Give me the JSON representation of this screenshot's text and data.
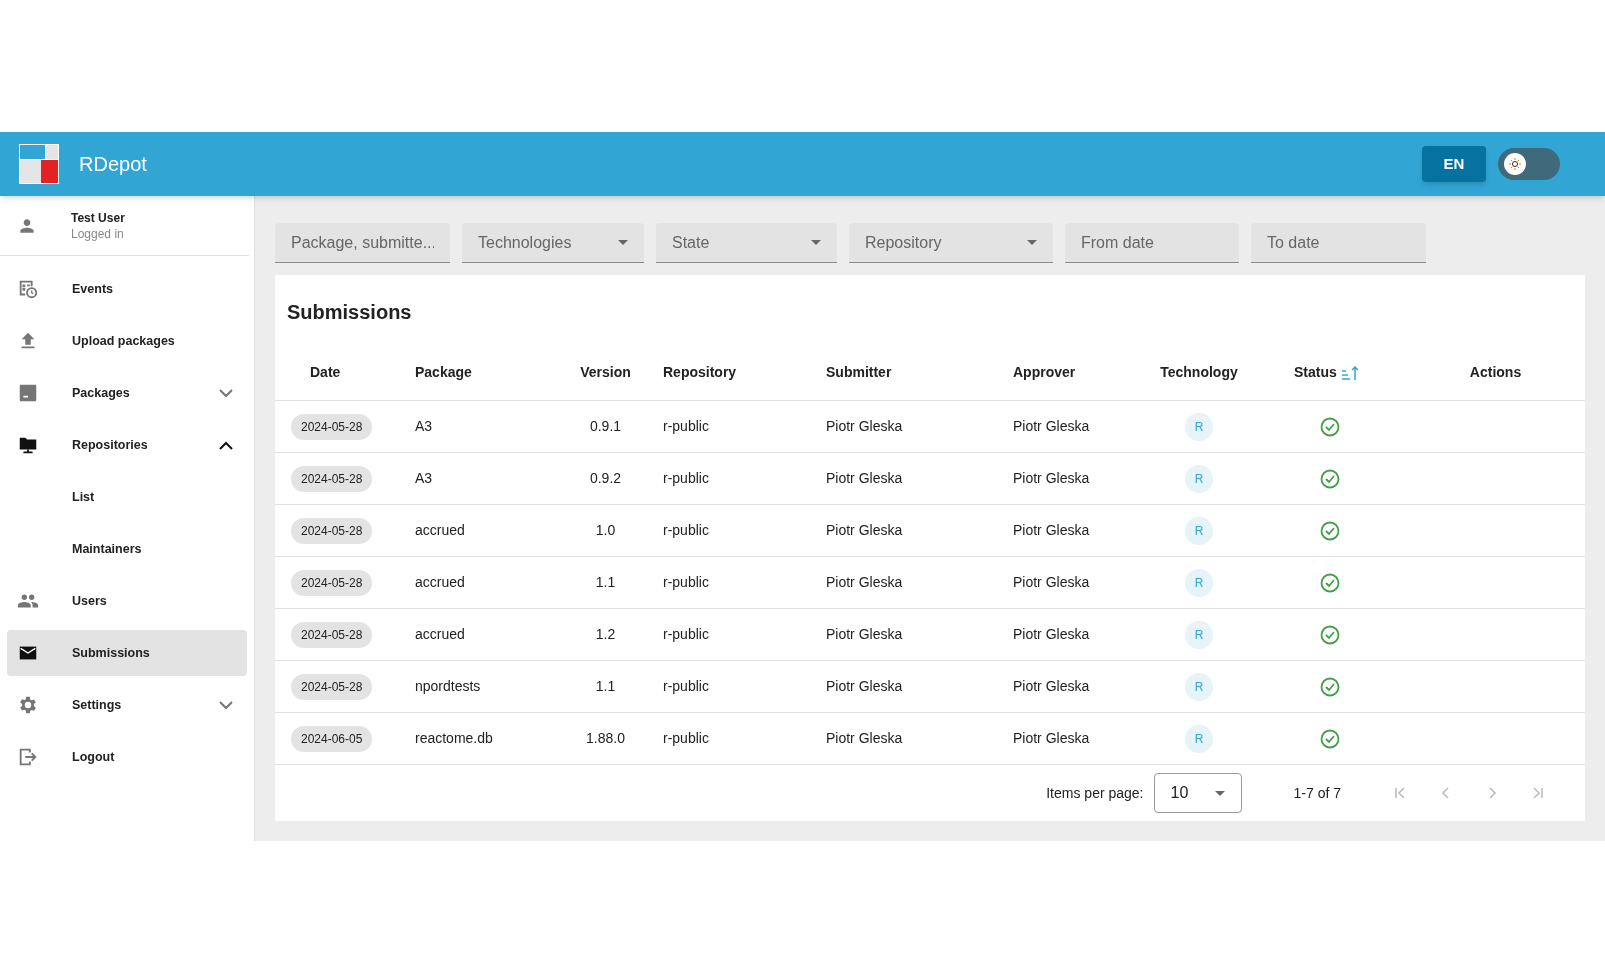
{
  "header": {
    "title": "RDepot",
    "language_button": "EN",
    "theme_toggle": {
      "on": false
    }
  },
  "user": {
    "name": "Test User",
    "status": "Logged in"
  },
  "sidebar": {
    "items": [
      {
        "label": "Events",
        "selected": false
      },
      {
        "label": "Upload packages",
        "selected": false
      },
      {
        "label": "Packages",
        "selected": false,
        "expanded": false
      },
      {
        "label": "Repositories",
        "selected": false,
        "expanded": true,
        "children": [
          {
            "label": "List",
            "selected": false
          },
          {
            "label": "Maintainers",
            "selected": false
          }
        ]
      },
      {
        "label": "Users",
        "selected": false
      },
      {
        "label": "Submissions",
        "selected": true
      },
      {
        "label": "Settings",
        "selected": false,
        "expanded": false
      },
      {
        "label": "Logout",
        "selected": false
      }
    ]
  },
  "filters": [
    {
      "kind": "text",
      "placeholder": "Package, submitte..."
    },
    {
      "kind": "select",
      "placeholder": "Technologies"
    },
    {
      "kind": "select",
      "placeholder": "State"
    },
    {
      "kind": "select",
      "placeholder": "Repository"
    },
    {
      "kind": "text",
      "placeholder": "From date"
    },
    {
      "kind": "text",
      "placeholder": "To date"
    }
  ],
  "table": {
    "title": "Submissions",
    "columns": [
      {
        "label": "Date",
        "sorted": false
      },
      {
        "label": "Package",
        "sorted": false
      },
      {
        "label": "Version",
        "sorted": false
      },
      {
        "label": "Repository",
        "sorted": false
      },
      {
        "label": "Submitter",
        "sorted": false
      },
      {
        "label": "Approver",
        "sorted": false
      },
      {
        "label": "Technology",
        "sorted": false
      },
      {
        "label": "Status",
        "sorted": true
      },
      {
        "label": "Actions",
        "sorted": false
      }
    ],
    "rows": [
      {
        "date": "2024-05-28",
        "package": "A3",
        "version": "0.9.1",
        "repository": "r-public",
        "submitter": "Piotr Gleska",
        "approver": "Piotr Gleska",
        "technology": "R",
        "accepted": true
      },
      {
        "date": "2024-05-28",
        "package": "A3",
        "version": "0.9.2",
        "repository": "r-public",
        "submitter": "Piotr Gleska",
        "approver": "Piotr Gleska",
        "technology": "R",
        "accepted": true
      },
      {
        "date": "2024-05-28",
        "package": "accrued",
        "version": "1.0",
        "repository": "r-public",
        "submitter": "Piotr Gleska",
        "approver": "Piotr Gleska",
        "technology": "R",
        "accepted": true
      },
      {
        "date": "2024-05-28",
        "package": "accrued",
        "version": "1.1",
        "repository": "r-public",
        "submitter": "Piotr Gleska",
        "approver": "Piotr Gleska",
        "technology": "R",
        "accepted": true
      },
      {
        "date": "2024-05-28",
        "package": "accrued",
        "version": "1.2",
        "repository": "r-public",
        "submitter": "Piotr Gleska",
        "approver": "Piotr Gleska",
        "technology": "R",
        "accepted": true
      },
      {
        "date": "2024-05-28",
        "package": "npordtests",
        "version": "1.1",
        "repository": "r-public",
        "submitter": "Piotr Gleska",
        "approver": "Piotr Gleska",
        "technology": "R",
        "accepted": true
      },
      {
        "date": "2024-06-05",
        "package": "reactome.db",
        "version": "1.88.0",
        "repository": "r-public",
        "submitter": "Piotr Gleska",
        "approver": "Piotr Gleska",
        "technology": "R",
        "accepted": true
      }
    ]
  },
  "pagination": {
    "label": "Items per page:",
    "page_size": "10",
    "range": "1-7 of 7",
    "first_disabled": true,
    "previous_disabled": true,
    "next_disabled": true,
    "last_disabled": true
  }
}
